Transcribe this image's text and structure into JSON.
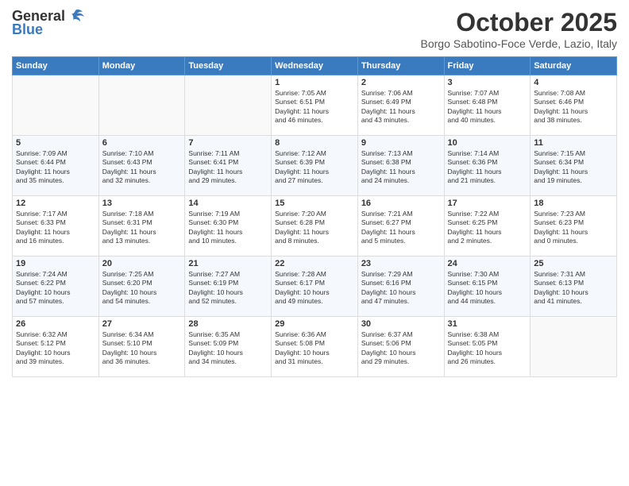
{
  "header": {
    "logo_general": "General",
    "logo_blue": "Blue",
    "month_title": "October 2025",
    "location": "Borgo Sabotino-Foce Verde, Lazio, Italy"
  },
  "weekdays": [
    "Sunday",
    "Monday",
    "Tuesday",
    "Wednesday",
    "Thursday",
    "Friday",
    "Saturday"
  ],
  "weeks": [
    [
      {
        "day": "",
        "info": ""
      },
      {
        "day": "",
        "info": ""
      },
      {
        "day": "",
        "info": ""
      },
      {
        "day": "1",
        "info": "Sunrise: 7:05 AM\nSunset: 6:51 PM\nDaylight: 11 hours\nand 46 minutes."
      },
      {
        "day": "2",
        "info": "Sunrise: 7:06 AM\nSunset: 6:49 PM\nDaylight: 11 hours\nand 43 minutes."
      },
      {
        "day": "3",
        "info": "Sunrise: 7:07 AM\nSunset: 6:48 PM\nDaylight: 11 hours\nand 40 minutes."
      },
      {
        "day": "4",
        "info": "Sunrise: 7:08 AM\nSunset: 6:46 PM\nDaylight: 11 hours\nand 38 minutes."
      }
    ],
    [
      {
        "day": "5",
        "info": "Sunrise: 7:09 AM\nSunset: 6:44 PM\nDaylight: 11 hours\nand 35 minutes."
      },
      {
        "day": "6",
        "info": "Sunrise: 7:10 AM\nSunset: 6:43 PM\nDaylight: 11 hours\nand 32 minutes."
      },
      {
        "day": "7",
        "info": "Sunrise: 7:11 AM\nSunset: 6:41 PM\nDaylight: 11 hours\nand 29 minutes."
      },
      {
        "day": "8",
        "info": "Sunrise: 7:12 AM\nSunset: 6:39 PM\nDaylight: 11 hours\nand 27 minutes."
      },
      {
        "day": "9",
        "info": "Sunrise: 7:13 AM\nSunset: 6:38 PM\nDaylight: 11 hours\nand 24 minutes."
      },
      {
        "day": "10",
        "info": "Sunrise: 7:14 AM\nSunset: 6:36 PM\nDaylight: 11 hours\nand 21 minutes."
      },
      {
        "day": "11",
        "info": "Sunrise: 7:15 AM\nSunset: 6:34 PM\nDaylight: 11 hours\nand 19 minutes."
      }
    ],
    [
      {
        "day": "12",
        "info": "Sunrise: 7:17 AM\nSunset: 6:33 PM\nDaylight: 11 hours\nand 16 minutes."
      },
      {
        "day": "13",
        "info": "Sunrise: 7:18 AM\nSunset: 6:31 PM\nDaylight: 11 hours\nand 13 minutes."
      },
      {
        "day": "14",
        "info": "Sunrise: 7:19 AM\nSunset: 6:30 PM\nDaylight: 11 hours\nand 10 minutes."
      },
      {
        "day": "15",
        "info": "Sunrise: 7:20 AM\nSunset: 6:28 PM\nDaylight: 11 hours\nand 8 minutes."
      },
      {
        "day": "16",
        "info": "Sunrise: 7:21 AM\nSunset: 6:27 PM\nDaylight: 11 hours\nand 5 minutes."
      },
      {
        "day": "17",
        "info": "Sunrise: 7:22 AM\nSunset: 6:25 PM\nDaylight: 11 hours\nand 2 minutes."
      },
      {
        "day": "18",
        "info": "Sunrise: 7:23 AM\nSunset: 6:23 PM\nDaylight: 11 hours\nand 0 minutes."
      }
    ],
    [
      {
        "day": "19",
        "info": "Sunrise: 7:24 AM\nSunset: 6:22 PM\nDaylight: 10 hours\nand 57 minutes."
      },
      {
        "day": "20",
        "info": "Sunrise: 7:25 AM\nSunset: 6:20 PM\nDaylight: 10 hours\nand 54 minutes."
      },
      {
        "day": "21",
        "info": "Sunrise: 7:27 AM\nSunset: 6:19 PM\nDaylight: 10 hours\nand 52 minutes."
      },
      {
        "day": "22",
        "info": "Sunrise: 7:28 AM\nSunset: 6:17 PM\nDaylight: 10 hours\nand 49 minutes."
      },
      {
        "day": "23",
        "info": "Sunrise: 7:29 AM\nSunset: 6:16 PM\nDaylight: 10 hours\nand 47 minutes."
      },
      {
        "day": "24",
        "info": "Sunrise: 7:30 AM\nSunset: 6:15 PM\nDaylight: 10 hours\nand 44 minutes."
      },
      {
        "day": "25",
        "info": "Sunrise: 7:31 AM\nSunset: 6:13 PM\nDaylight: 10 hours\nand 41 minutes."
      }
    ],
    [
      {
        "day": "26",
        "info": "Sunrise: 6:32 AM\nSunset: 5:12 PM\nDaylight: 10 hours\nand 39 minutes."
      },
      {
        "day": "27",
        "info": "Sunrise: 6:34 AM\nSunset: 5:10 PM\nDaylight: 10 hours\nand 36 minutes."
      },
      {
        "day": "28",
        "info": "Sunrise: 6:35 AM\nSunset: 5:09 PM\nDaylight: 10 hours\nand 34 minutes."
      },
      {
        "day": "29",
        "info": "Sunrise: 6:36 AM\nSunset: 5:08 PM\nDaylight: 10 hours\nand 31 minutes."
      },
      {
        "day": "30",
        "info": "Sunrise: 6:37 AM\nSunset: 5:06 PM\nDaylight: 10 hours\nand 29 minutes."
      },
      {
        "day": "31",
        "info": "Sunrise: 6:38 AM\nSunset: 5:05 PM\nDaylight: 10 hours\nand 26 minutes."
      },
      {
        "day": "",
        "info": ""
      }
    ]
  ]
}
